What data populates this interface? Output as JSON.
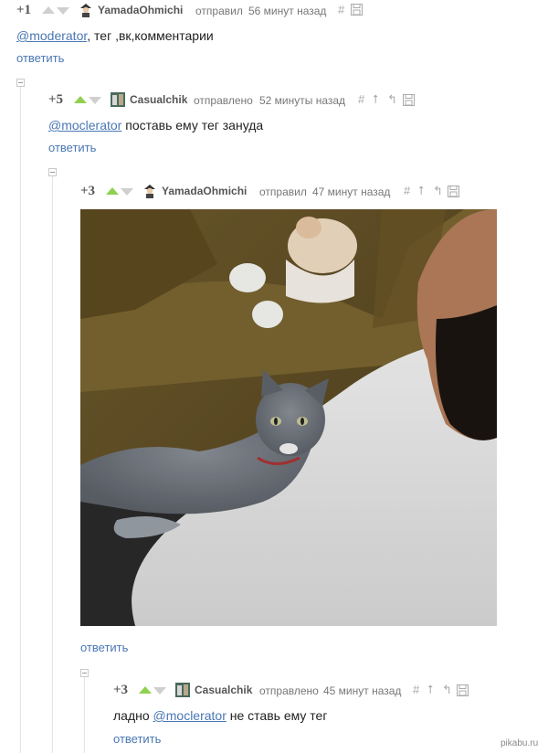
{
  "comments": [
    {
      "rating": "+1",
      "author": "YamadaOhmichi",
      "action": "отправил",
      "time": "56 минут назад",
      "text_parts": {
        "mention": "@moderator",
        "rest": ", тег ,вк,комментарии"
      },
      "reply": "ответить"
    },
    {
      "rating": "+5",
      "author": "Casualchik",
      "action": "отправлено",
      "time": "52 минуты назад",
      "text_parts": {
        "mention": "@moclerator",
        "rest": " поставь ему тег зануда"
      },
      "reply": "ответить"
    },
    {
      "rating": "+3",
      "author": "YamadaOhmichi",
      "action": "отправил",
      "time": "47 минут назад",
      "image_alt": "cat lying on a man's chest on a couch",
      "reply": "ответить"
    },
    {
      "rating": "+3",
      "author": "Casualchik",
      "action": "отправлено",
      "time": "45 минут назад",
      "text_parts": {
        "prefix": "ладно ",
        "mention": "@moclerator",
        "rest": " не ставь ему тег"
      },
      "reply": "ответить"
    }
  ],
  "icons": {
    "hash": "#",
    "up": "⭡",
    "parent": "↰",
    "save": "save-icon"
  },
  "watermark": "pikabu.ru",
  "colors": {
    "upvote_active": "#8fd14f",
    "link": "#4a77b4"
  }
}
